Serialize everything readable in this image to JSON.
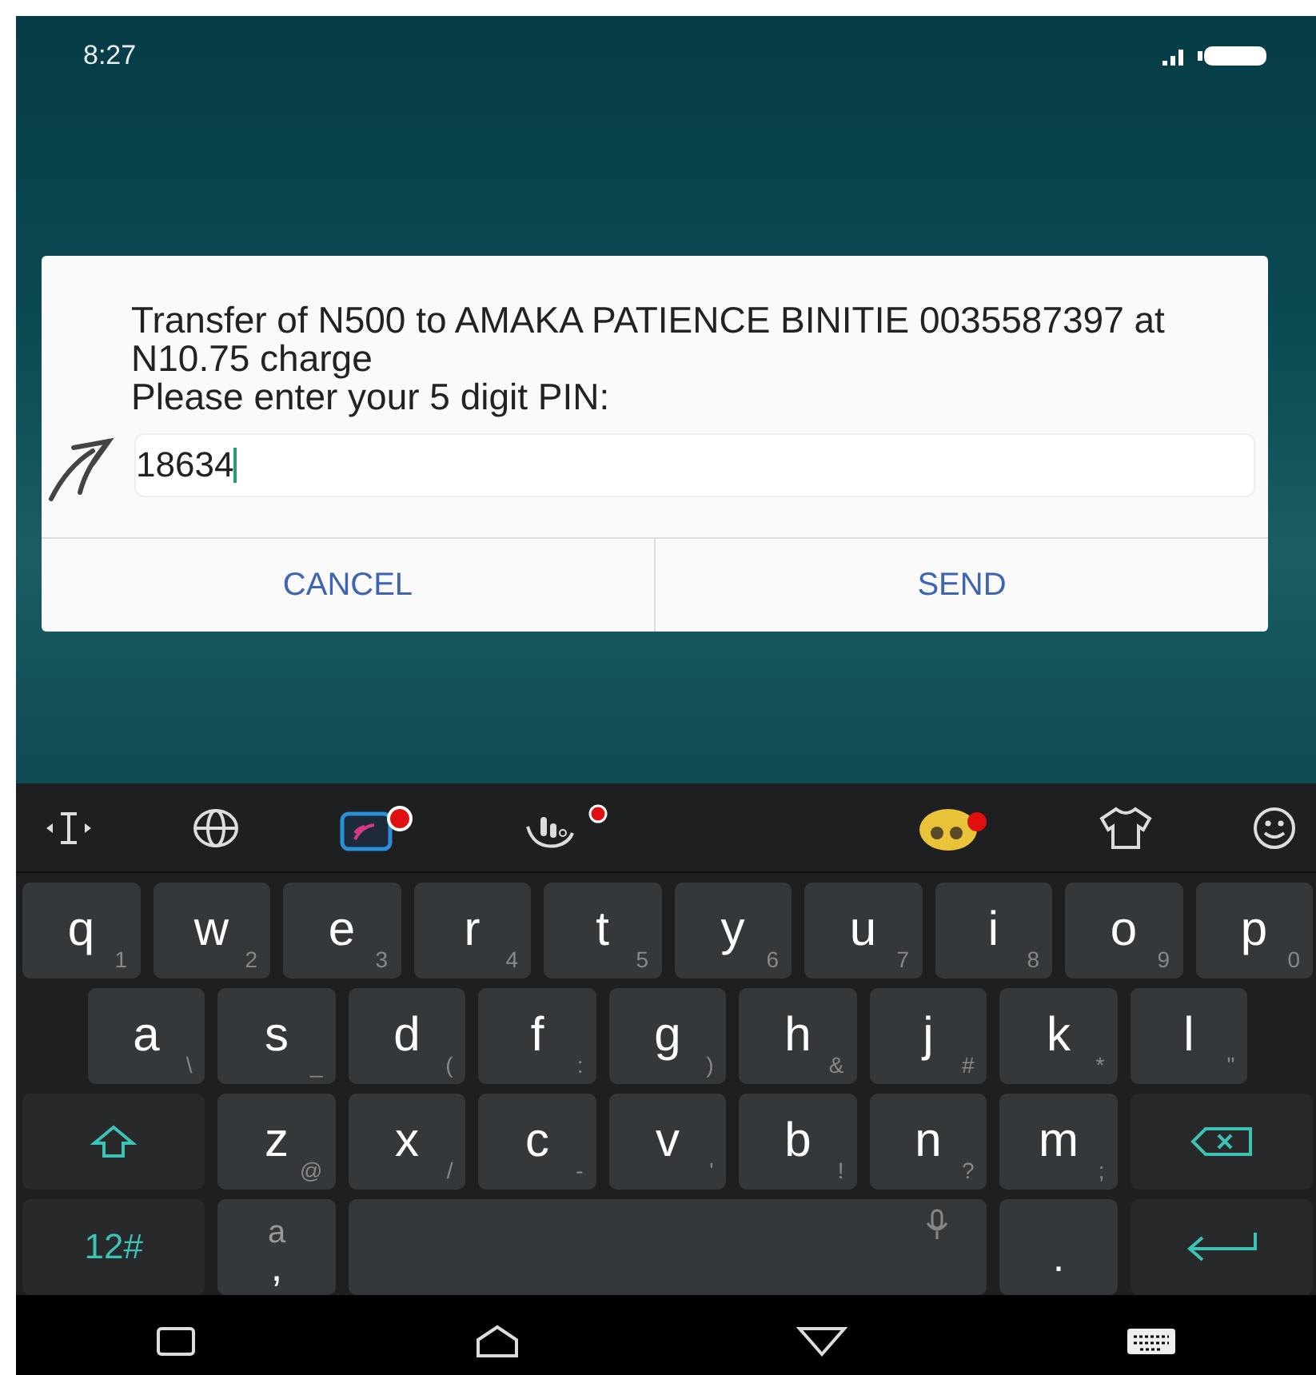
{
  "status_bar": {
    "time": "8:27"
  },
  "dialog": {
    "message": "Transfer of N500 to AMAKA PATIENCE BINITIE 0035587397 at N10.75 charge\nPlease enter your 5 digit PIN:",
    "pin_value": "18634",
    "buttons": [
      "CANCEL",
      "SEND"
    ]
  },
  "keyboard": {
    "letter_rows": [
      [
        {
          "kind": "char",
          "label": "q",
          "hint": "1"
        },
        {
          "kind": "char",
          "label": "w",
          "hint": "2"
        },
        {
          "kind": "char",
          "label": "e",
          "hint": "3"
        },
        {
          "kind": "char",
          "label": "r",
          "hint": "4"
        },
        {
          "kind": "char",
          "label": "t",
          "hint": "5"
        },
        {
          "kind": "char",
          "label": "y",
          "hint": "6"
        },
        {
          "kind": "char",
          "label": "u",
          "hint": "7"
        },
        {
          "kind": "char",
          "label": "i",
          "hint": "8"
        },
        {
          "kind": "char",
          "label": "o",
          "hint": "9"
        },
        {
          "kind": "char",
          "label": "p",
          "hint": "0"
        }
      ],
      [
        {
          "kind": "char",
          "label": "a",
          "hint": "\\"
        },
        {
          "kind": "char",
          "label": "s",
          "hint": "_"
        },
        {
          "kind": "char",
          "label": "d",
          "hint": "("
        },
        {
          "kind": "char",
          "label": "f",
          "hint": ":"
        },
        {
          "kind": "char",
          "label": "g",
          "hint": ")"
        },
        {
          "kind": "char",
          "label": "h",
          "hint": "&"
        },
        {
          "kind": "char",
          "label": "j",
          "hint": "#"
        },
        {
          "kind": "char",
          "label": "k",
          "hint": "*"
        },
        {
          "kind": "char",
          "label": "l",
          "hint": "\""
        }
      ],
      [
        {
          "kind": "shift"
        },
        {
          "kind": "char",
          "label": "z",
          "hint": "@"
        },
        {
          "kind": "char",
          "label": "x",
          "hint": "/"
        },
        {
          "kind": "char",
          "label": "c",
          "hint": "-"
        },
        {
          "kind": "char",
          "label": "v",
          "hint": "'"
        },
        {
          "kind": "char",
          "label": "b",
          "hint": "!"
        },
        {
          "kind": "char",
          "label": "n",
          "hint": "?"
        },
        {
          "kind": "char",
          "label": "m",
          "hint": ";"
        },
        {
          "kind": "backspace"
        }
      ]
    ],
    "bottom_row": [
      {
        "kind": "symbols",
        "label": "12#"
      },
      {
        "kind": "comma",
        "label": ",",
        "hint": "a"
      },
      {
        "kind": "space"
      },
      {
        "kind": "period",
        "label": "."
      },
      {
        "kind": "enter"
      }
    ]
  }
}
